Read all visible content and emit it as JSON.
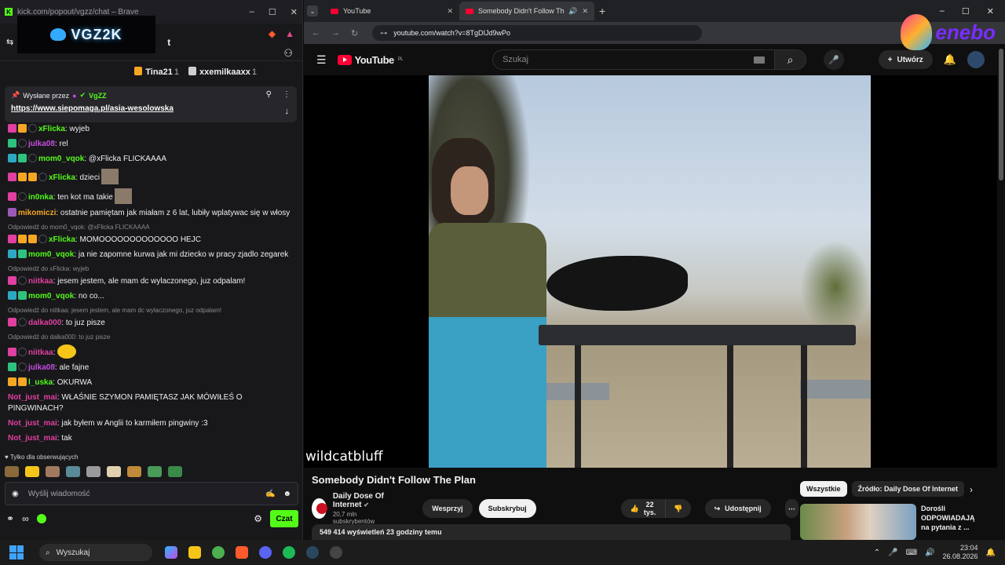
{
  "kick": {
    "window_url": "kick.com/popout/vgzz/chat – Brave",
    "banner_text": "VGZ2K",
    "chat_title": "t",
    "toppers": [
      {
        "name": "Tina21",
        "count": "1",
        "medal_color": "#f5a623"
      },
      {
        "name": "xxemilkaaxx",
        "count": "1",
        "medal_color": "#cfcfd2"
      }
    ],
    "pinned": {
      "sent_by_label": "Wysłane przez",
      "sender": "VgZZ",
      "link": "https://www.siepomaga.pl/asia-wesolowska"
    },
    "messages": [
      {
        "reply": "",
        "user": "xFlicka",
        "user_color": "#53fc18",
        "text": "wyjeb"
      },
      {
        "reply": "",
        "user": "julka08",
        "user_color": "#c34ce0",
        "text": "rel"
      },
      {
        "reply": "",
        "user": "mom0_vqok",
        "user_color": "#53fc18",
        "text": "@xFlicka FLICKAAAA"
      },
      {
        "reply": "",
        "user": "xFlicka",
        "user_color": "#53fc18",
        "text": "dzieci"
      },
      {
        "reply": "",
        "user": "in0nka",
        "user_color": "#53fc18",
        "text": "ten kot ma takie"
      },
      {
        "reply": "",
        "user": "mikomiczi",
        "user_color": "#f5a623",
        "text": "ostatnie pamiętam jak miałam z 6 lat, lubiły wplatywac się w włosy"
      },
      {
        "reply": "Odpowiedź do mom0_vqok: @xFlicka FLICKAAAA",
        "user": "xFlicka",
        "user_color": "#53fc18",
        "text": "MOMOOOOOOOOOOOOO HEJC"
      },
      {
        "reply": "",
        "user": "mom0_vqok",
        "user_color": "#53fc18",
        "text": "ja nie zapomne kurwa jak mi dziecko w pracy zjadlo zegarek"
      },
      {
        "reply": "Odpowiedź do xFlicka: wyjeb",
        "user": "niitkaa",
        "user_color": "#e040a0",
        "text": "jesem jestem, ale mam dc wylaczonego, juz odpalam!"
      },
      {
        "reply": "",
        "user": "mom0_vqok",
        "user_color": "#53fc18",
        "text": "no co..."
      },
      {
        "reply": "Odpowiedź do niitkaa: jesem jestem, ale mam dc wylaczonego, juz odpalam!",
        "user": "dalka000",
        "user_color": "#e040a0",
        "text": "to juz pisze"
      },
      {
        "reply": "Odpowiedź do dalka000: to juz pisze",
        "user": "niitkaa",
        "user_color": "#e040a0",
        "text": ""
      },
      {
        "reply": "",
        "user": "julka08",
        "user_color": "#c34ce0",
        "text": "ale fajne"
      },
      {
        "reply": "",
        "user": "l_uska",
        "user_color": "#53fc18",
        "text": "OKURWA"
      },
      {
        "reply": "",
        "user": "Not_just_mai",
        "user_color": "#e040a0",
        "text": "WŁAŚNIE SZYMON PAMIĘTASZ JAK MÓWIŁEŚ O PINGWINACH?"
      },
      {
        "reply": "",
        "user": "Not_just_mai",
        "user_color": "#e040a0",
        "text": "jak byłem w Anglii to karmiłem pingwiny :3"
      },
      {
        "reply": "",
        "user": "Not_just_mai",
        "user_color": "#e040a0",
        "text": "tak"
      }
    ],
    "follow_only": "Tylko dla obserwujących",
    "input_placeholder": "Wyślij wiadomość",
    "send_label": "Czat"
  },
  "browser": {
    "tabs": [
      {
        "label": "YouTube"
      },
      {
        "label": "Somebody Didn't Follow Th"
      }
    ],
    "url": "youtube.com/watch?v=8TgDIJd9wPo",
    "ad_text": "enebo"
  },
  "youtube": {
    "logo": "YouTube",
    "region": "PL",
    "search_placeholder": "Szukaj",
    "create_label": "Utwórz",
    "video_watermark": "wildcatbluff",
    "title": "Somebody Didn't Follow The Plan",
    "channel": "Daily Dose Of Internet",
    "subscribers": "20,7 mln subskrybentów",
    "support_label": "Wesprzyj",
    "subscribe_label": "Subskrybuj",
    "likes": "22 tys.",
    "share_label": "Udostępnij",
    "views_line": "549 414 wyświetleń  23 godziny temu",
    "chips": [
      "Wszystkie",
      "Źródło: Daily Dose Of Internet"
    ],
    "recommended_title": "Dorośli ODPOWIADAJĄ na pytania z ..."
  },
  "taskbar": {
    "search_label": "Wyszukaj",
    "time": "23:04",
    "date": "26.08.2026"
  }
}
